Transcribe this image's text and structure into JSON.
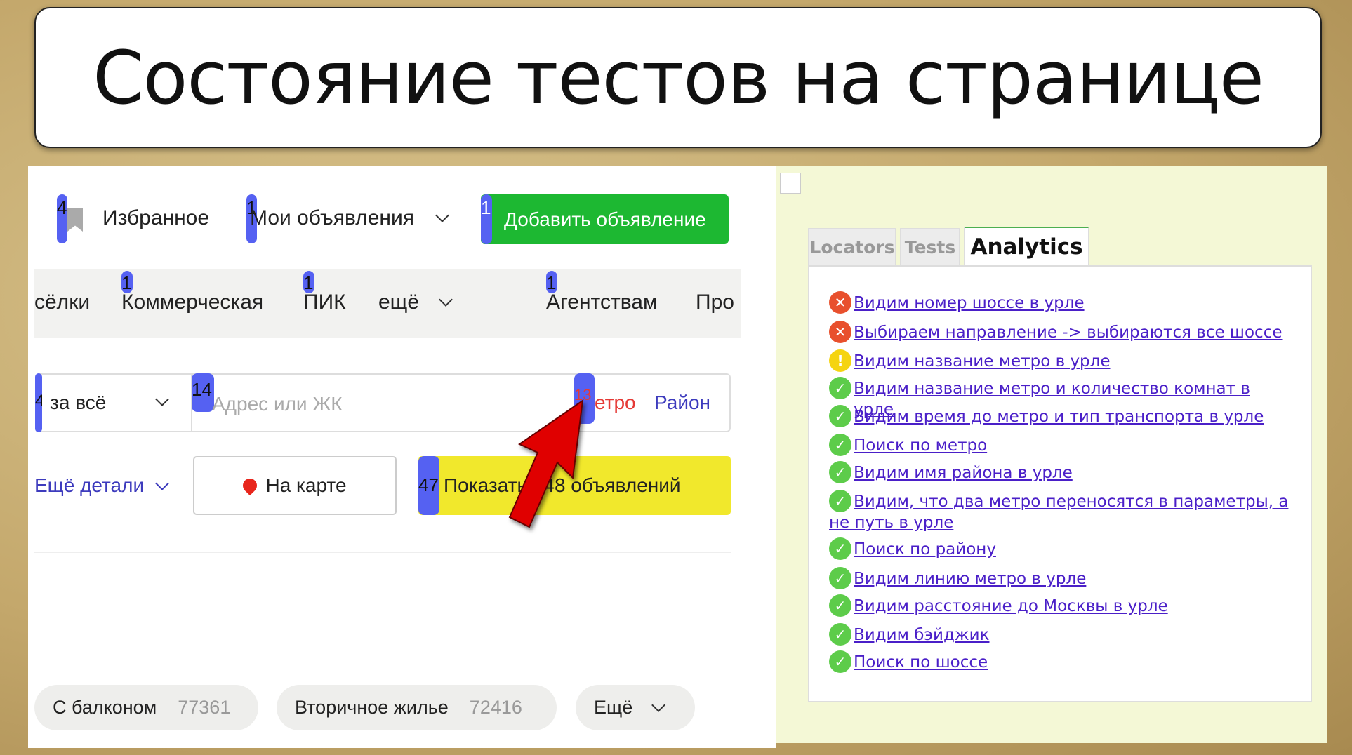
{
  "slide_title": "Состояние тестов на странице",
  "header": {
    "favorites": {
      "badge": "4",
      "label": "Избранное"
    },
    "my_ads": {
      "badge": "1",
      "label": "Мои объявления"
    },
    "add_ad": {
      "badge": "1",
      "label": "Добавить объявление"
    }
  },
  "nav": [
    {
      "label": "сёлки"
    },
    {
      "badge": "1",
      "label": "Коммерческая"
    },
    {
      "badge": "1",
      "label": "ПИК"
    },
    {
      "label": "ещё"
    },
    {
      "badge": "1",
      "label": "Агентствам"
    },
    {
      "label": "Про"
    }
  ],
  "search": {
    "price_badge": "4",
    "price_select": "за всё",
    "address_badge": "14",
    "address_placeholder": "Адрес или ЖК",
    "metro_badge": "13",
    "metro_label": "етро",
    "district_label": "Район"
  },
  "actions": {
    "more_details": "Ещё детали",
    "map_button": "На карте",
    "show_badge": "47",
    "show_button": "Показать 148 объявлений"
  },
  "chips": [
    {
      "label": "С балконом",
      "count": "77361"
    },
    {
      "label": "Вторичное жилье",
      "count": "72416"
    },
    {
      "label": "Ещё"
    }
  ],
  "panel": {
    "tabs": [
      {
        "label": "Locators"
      },
      {
        "label": "Tests"
      },
      {
        "label": "Analytics",
        "active": true
      }
    ],
    "tests": [
      {
        "status": "fail",
        "label": "Видим номер шоссе в урле"
      },
      {
        "status": "fail",
        "label": "Выбираем направление -> выбираются все шоссе"
      },
      {
        "status": "warning",
        "label": "Видим название метро в урле"
      },
      {
        "status": "pass",
        "label": "Видим название метро и количество комнат в урле"
      },
      {
        "status": "pass",
        "label": "Видим время до метро и тип транспорта в урле"
      },
      {
        "status": "pass",
        "label": "Поиск по метро"
      },
      {
        "status": "pass",
        "label": "Видим имя района в урле"
      },
      {
        "status": "pass",
        "label": "Видим, что два метро переносятся в параметры, а не путь в урле"
      },
      {
        "status": "pass",
        "label": "Поиск по району"
      },
      {
        "status": "pass",
        "label": "Видим линию метро в урле"
      },
      {
        "status": "pass",
        "label": "Видим расстояние до Москвы в урле"
      },
      {
        "status": "pass",
        "label": "Видим бэйджик"
      },
      {
        "status": "pass",
        "label": "Поиск по шоссе"
      }
    ]
  },
  "colors": {
    "badge": "#5561f2",
    "add_button": "#1db832",
    "show_button": "#f1e82c",
    "fail": "#e8502d",
    "warning": "#f5d410",
    "pass": "#5dcc4a",
    "link": "#4a1fc8",
    "arrow": "#e00000"
  }
}
